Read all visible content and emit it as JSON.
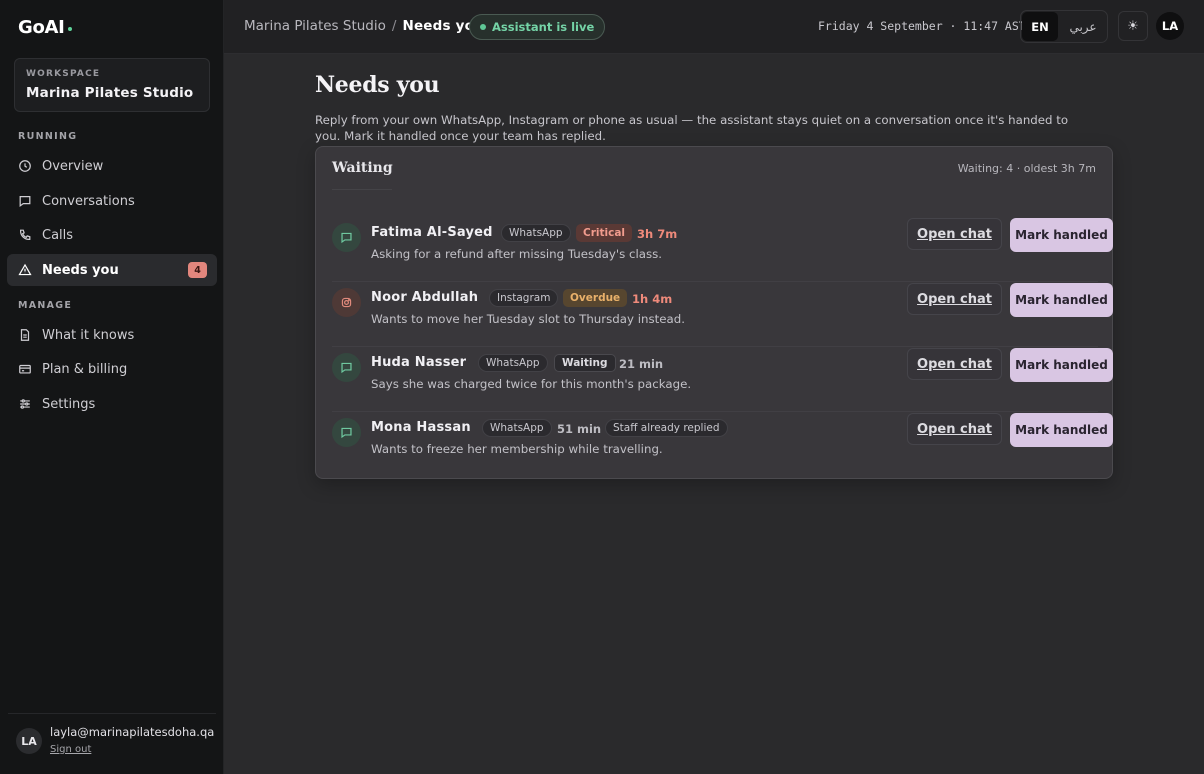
{
  "app": {
    "logo": "GoAI"
  },
  "sidebar": {
    "workspace_label": "WORKSPACE",
    "workspace_name": "Marina Pilates Studio",
    "section_running": "RUNNING",
    "section_manage": "MANAGE",
    "items": [
      {
        "label": "Overview",
        "icon": "clock-icon"
      },
      {
        "label": "Conversations",
        "icon": "chat-icon"
      },
      {
        "label": "Calls",
        "icon": "phone-icon"
      },
      {
        "label": "Needs you",
        "icon": "warning-icon",
        "badge": "4",
        "active": true
      },
      {
        "label": "What it knows",
        "icon": "document-icon"
      },
      {
        "label": "Plan & billing",
        "icon": "card-icon"
      },
      {
        "label": "Settings",
        "icon": "sliders-icon"
      }
    ],
    "footer": {
      "avatar": "LA",
      "email": "layla@marinapilatesdoha.qa",
      "signout": "Sign out"
    }
  },
  "topbar": {
    "breadcrumb_root": "Marina Pilates Studio",
    "breadcrumb_sep": "/",
    "breadcrumb_current": "Needs you",
    "live_label": "Assistant is live",
    "datetime": "Friday 4 September · 11:47 AST",
    "lang_en": "EN",
    "lang_ar": "عربي",
    "theme_icon": "☀",
    "avatar": "LA"
  },
  "main": {
    "title": "Needs you",
    "description": "Reply from your own WhatsApp, Instagram or phone as usual — the assistant stays quiet on a conversation once it's handed to you. Mark it handled once your team has replied.",
    "panel": {
      "title": "Waiting",
      "meta": "Waiting: 4 · oldest 3h 7m",
      "open_label": "Open chat",
      "mark_label": "Mark handled",
      "rows": [
        {
          "name": "Fatima Al-Sayed",
          "channel": "WhatsApp",
          "status": "Critical",
          "elapsed": "3h 7m",
          "desc": "Asking for a refund after missing Tuesday's class."
        },
        {
          "name": "Noor Abdullah",
          "channel": "Instagram",
          "status": "Overdue",
          "elapsed": "1h 4m",
          "desc": "Wants to move her Tuesday slot to Thursday instead."
        },
        {
          "name": "Huda Nasser",
          "channel": "WhatsApp",
          "status": "Waiting",
          "elapsed": "21 min",
          "desc": "Says she was charged twice for this month's package."
        },
        {
          "name": "Mona Hassan",
          "channel": "WhatsApp",
          "elapsed": "51 min",
          "note": "Staff already replied",
          "desc": "Wants to freeze her membership while travelling."
        }
      ]
    }
  },
  "colors": {
    "accent": "#d9c6e3",
    "live": "#74d3a6",
    "critical": "#f19c8e",
    "overdue": "#e9b16a"
  }
}
